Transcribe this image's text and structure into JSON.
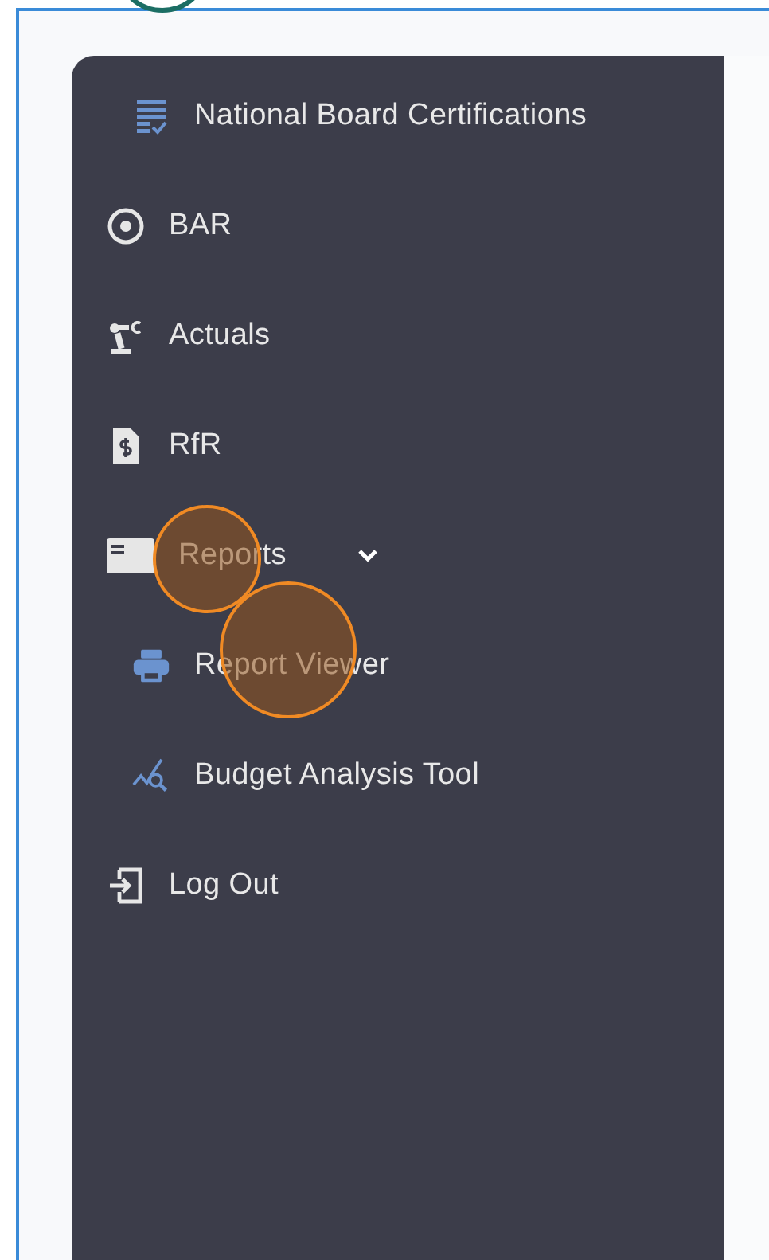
{
  "sidebar": {
    "items": [
      {
        "label": "National Board Certifications",
        "kind": "subitem",
        "click_marker": false
      },
      {
        "label": "BAR",
        "kind": "item",
        "click_marker": false
      },
      {
        "label": "Actuals",
        "kind": "item",
        "click_marker": false
      },
      {
        "label": "RfR",
        "kind": "item",
        "click_marker": false
      },
      {
        "label": "Reports",
        "kind": "group",
        "expanded": true,
        "click_marker": true,
        "children": [
          {
            "label": "Report Viewer",
            "click_marker": true
          },
          {
            "label": "Budget Analysis Tool",
            "click_marker": false
          }
        ]
      },
      {
        "label": "Log Out",
        "kind": "item",
        "click_marker": false
      }
    ]
  }
}
